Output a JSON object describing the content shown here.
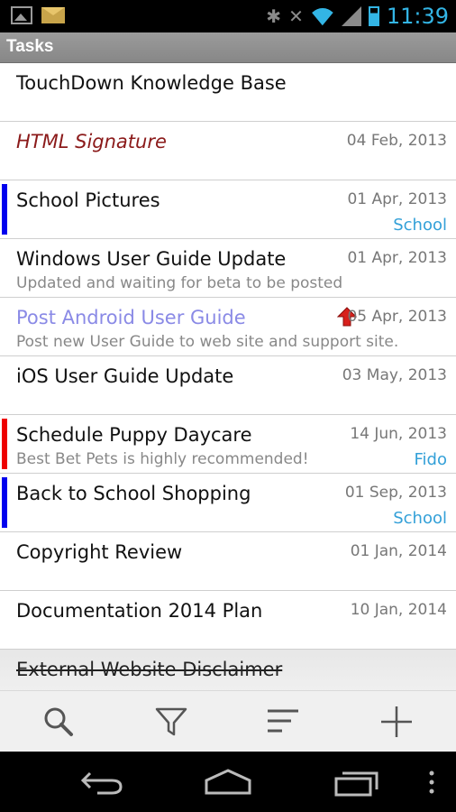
{
  "status_bar": {
    "time": "11:39",
    "icons": [
      "gallery-icon",
      "mail-icon",
      "bluetooth-icon",
      "mute-icon",
      "wifi-icon",
      "signal-icon",
      "battery-icon"
    ]
  },
  "header": {
    "title": "Tasks"
  },
  "tasks": [
    {
      "title": "TouchDown Knowledge Base",
      "date": "",
      "subtitle": "",
      "category": "",
      "flag_color": "",
      "style": "normal"
    },
    {
      "title": "HTML Signature",
      "date": "04 Feb, 2013",
      "subtitle": "",
      "category": "",
      "flag_color": "",
      "style": "italic"
    },
    {
      "title": "School Pictures",
      "date": "01 Apr, 2013",
      "subtitle": "",
      "category": "School",
      "flag_color": "#0000ee",
      "style": "normal"
    },
    {
      "title": "Windows User Guide Update",
      "date": "01 Apr, 2013",
      "subtitle": "Updated and waiting for beta to be posted",
      "category": "",
      "flag_color": "",
      "style": "normal"
    },
    {
      "title": "Post Android User Guide",
      "date": "05 Apr, 2013",
      "subtitle": "Post new User Guide to web site and support site.",
      "category": "",
      "flag_color": "",
      "style": "highlight",
      "priority_icon": "high-priority-arrow-icon"
    },
    {
      "title": "iOS User Guide Update",
      "date": "03 May, 2013",
      "subtitle": "",
      "category": "",
      "flag_color": "",
      "style": "normal"
    },
    {
      "title": "Schedule Puppy Daycare",
      "date": "14 Jun, 2013",
      "subtitle": "Best Bet Pets is highly recommended!",
      "category": "Fido",
      "flag_color": "#ee0000",
      "style": "normal"
    },
    {
      "title": "Back to School Shopping",
      "date": "01 Sep, 2013",
      "subtitle": "",
      "category": "School",
      "flag_color": "#0000ee",
      "style": "normal"
    },
    {
      "title": "Copyright Review",
      "date": "01 Jan, 2014",
      "subtitle": "",
      "category": "",
      "flag_color": "",
      "style": "normal"
    },
    {
      "title": "Documentation 2014 Plan",
      "date": "10 Jan, 2014",
      "subtitle": "",
      "category": "",
      "flag_color": "",
      "style": "normal"
    },
    {
      "title": "External Website Disclaimer",
      "date": "",
      "subtitle": "",
      "category": "",
      "flag_color": "",
      "style": "struck"
    }
  ],
  "toolbar": {
    "buttons": [
      "search-icon",
      "filter-icon",
      "sort-icon",
      "add-icon"
    ]
  },
  "navbar": {
    "buttons": [
      "back-icon",
      "home-icon",
      "recent-apps-icon",
      "menu-icon"
    ]
  },
  "colors": {
    "accent": "#33b5e5",
    "category": "#33a0d8",
    "flag_blue": "#0000ee",
    "flag_red": "#ee0000",
    "italic_title": "#8b1a1a",
    "highlight_title": "#8a8ae6"
  }
}
